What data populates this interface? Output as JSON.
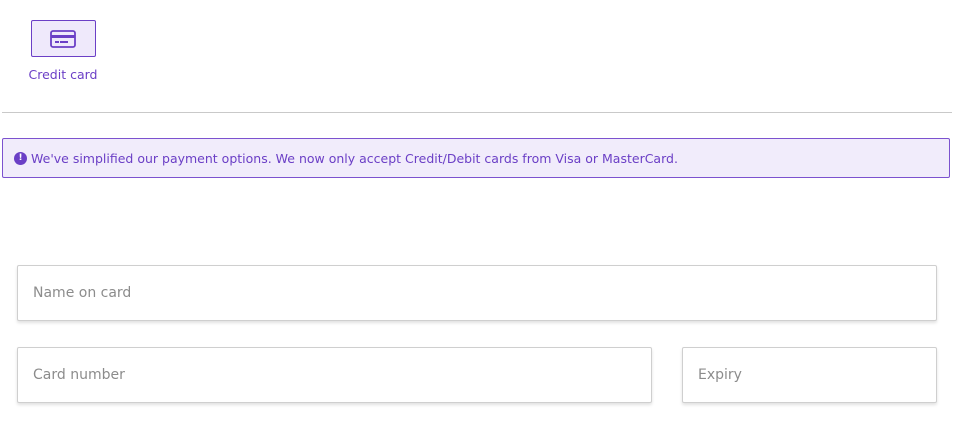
{
  "payment_methods": [
    {
      "label": "Credit card",
      "icon": "credit-card-icon",
      "selected": true
    }
  ],
  "notice": {
    "icon": "exclamation-circle-icon",
    "text": "We've simplified our payment options. We now only accept Credit/Debit cards from Visa or MasterCard."
  },
  "form": {
    "name_on_card": {
      "value": "",
      "placeholder": "Name on card"
    },
    "card_number": {
      "value": "",
      "placeholder": "Card number"
    },
    "expiry": {
      "value": "",
      "placeholder": "Expiry"
    }
  },
  "colors": {
    "accent": "#6b3fc6",
    "notice_bg": "#f1ecfb",
    "tile_bg": "#efe9fb",
    "border": "#cfcfcf"
  }
}
